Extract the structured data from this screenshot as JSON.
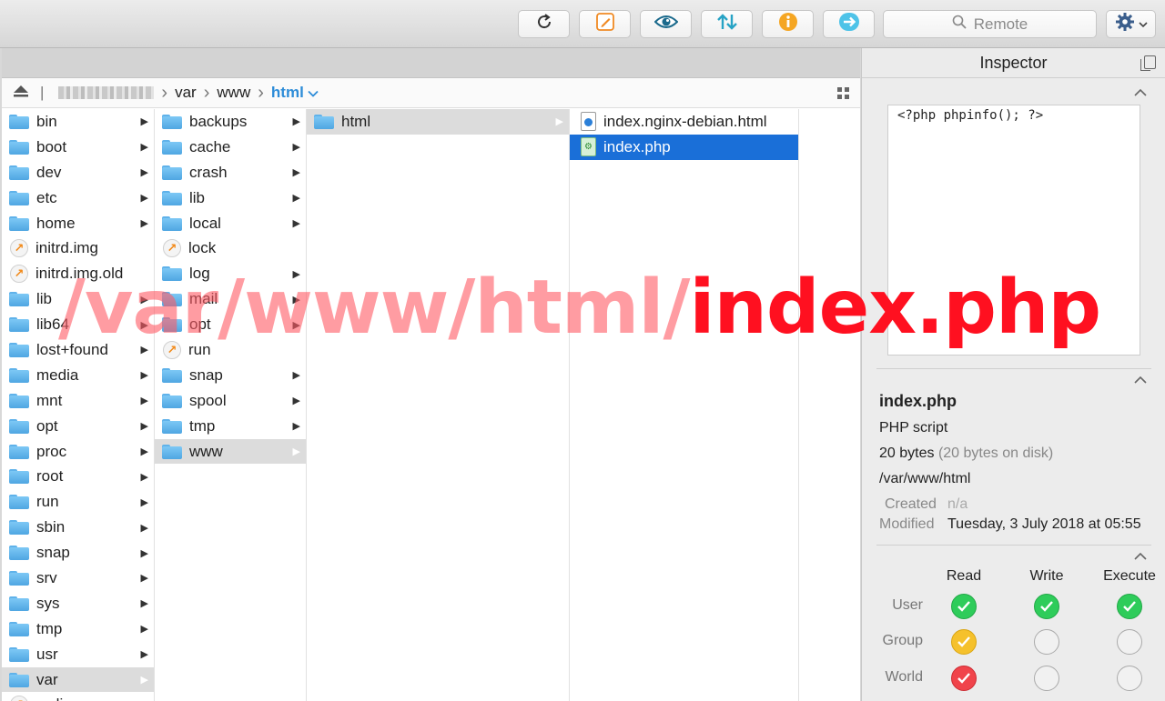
{
  "toolbar": {
    "buttons": [
      {
        "id": "refresh",
        "icon": "refresh-icon"
      },
      {
        "id": "edit",
        "icon": "edit-icon"
      },
      {
        "id": "quicklook",
        "icon": "eye-icon"
      },
      {
        "id": "transfer",
        "icon": "sync-arrows-icon"
      },
      {
        "id": "info",
        "icon": "info-icon"
      },
      {
        "id": "goto",
        "icon": "arrow-right-icon"
      }
    ],
    "search_placeholder": "Remote",
    "gear_icon": "gear-icon"
  },
  "path": {
    "segments": [
      "var",
      "www"
    ],
    "current": "html"
  },
  "columns": [
    {
      "items": [
        {
          "name": "bin",
          "type": "folder"
        },
        {
          "name": "boot",
          "type": "folder"
        },
        {
          "name": "dev",
          "type": "folder"
        },
        {
          "name": "etc",
          "type": "folder"
        },
        {
          "name": "home",
          "type": "folder"
        },
        {
          "name": "initrd.img",
          "type": "alias"
        },
        {
          "name": "initrd.img.old",
          "type": "alias"
        },
        {
          "name": "lib",
          "type": "folder"
        },
        {
          "name": "lib64",
          "type": "folder"
        },
        {
          "name": "lost+found",
          "type": "folder"
        },
        {
          "name": "media",
          "type": "folder"
        },
        {
          "name": "mnt",
          "type": "folder"
        },
        {
          "name": "opt",
          "type": "folder"
        },
        {
          "name": "proc",
          "type": "folder"
        },
        {
          "name": "root",
          "type": "folder"
        },
        {
          "name": "run",
          "type": "folder"
        },
        {
          "name": "sbin",
          "type": "folder"
        },
        {
          "name": "snap",
          "type": "folder"
        },
        {
          "name": "srv",
          "type": "folder"
        },
        {
          "name": "sys",
          "type": "folder"
        },
        {
          "name": "tmp",
          "type": "folder"
        },
        {
          "name": "usr",
          "type": "folder"
        },
        {
          "name": "var",
          "type": "folder",
          "selected": "grey"
        },
        {
          "name": "vmlinuz",
          "type": "alias"
        }
      ]
    },
    {
      "items": [
        {
          "name": "backups",
          "type": "folder"
        },
        {
          "name": "cache",
          "type": "folder"
        },
        {
          "name": "crash",
          "type": "folder"
        },
        {
          "name": "lib",
          "type": "folder"
        },
        {
          "name": "local",
          "type": "folder"
        },
        {
          "name": "lock",
          "type": "alias"
        },
        {
          "name": "log",
          "type": "folder"
        },
        {
          "name": "mail",
          "type": "folder"
        },
        {
          "name": "opt",
          "type": "folder"
        },
        {
          "name": "run",
          "type": "alias"
        },
        {
          "name": "snap",
          "type": "folder"
        },
        {
          "name": "spool",
          "type": "folder"
        },
        {
          "name": "tmp",
          "type": "folder"
        },
        {
          "name": "www",
          "type": "folder",
          "selected": "grey"
        }
      ]
    },
    {
      "items": [
        {
          "name": "html",
          "type": "folder",
          "selected": "grey"
        }
      ]
    },
    {
      "items": [
        {
          "name": "index.nginx-debian.html",
          "type": "html"
        },
        {
          "name": "index.php",
          "type": "php",
          "selected": "blue"
        }
      ]
    }
  ],
  "inspector": {
    "title": "Inspector",
    "preview": "<?php phpinfo(); ?>",
    "name": "index.php",
    "kind": "PHP script",
    "size": "20 bytes",
    "size_on_disk": "(20 bytes on disk)",
    "path": "/var/www/html",
    "created_label": "Created",
    "created_value": "n/a",
    "modified_label": "Modified",
    "modified_value": "Tuesday, 3 July 2018 at 05:55",
    "permissions": {
      "headers": [
        "Read",
        "Write",
        "Execute"
      ],
      "rows": [
        {
          "label": "User",
          "values": [
            "green",
            "green",
            "green"
          ]
        },
        {
          "label": "Group",
          "values": [
            "yellow",
            "off",
            "off"
          ]
        },
        {
          "label": "World",
          "values": [
            "red",
            "off",
            "off"
          ]
        }
      ]
    }
  },
  "overlay": {
    "prefix": "/var/www/html/",
    "filename": "index.php"
  }
}
